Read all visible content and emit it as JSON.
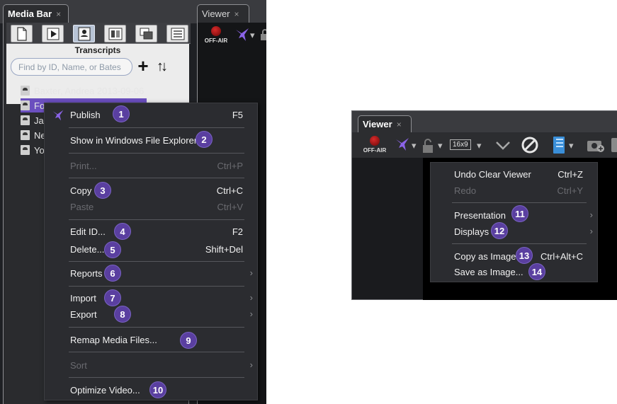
{
  "left": {
    "tabs": {
      "media_bar": "Media Bar",
      "viewer": "Viewer",
      "close_glyph": "×"
    },
    "transcripts_title": "Transcripts",
    "search": {
      "placeholder": "Find by ID, Name, or Bates"
    },
    "plus_glyph": "+",
    "sort_glyph": "↑↓",
    "tree_items": [
      {
        "label": "Baxter, Andrea 2013-09-06"
      },
      {
        "label": "Fo"
      },
      {
        "label": "Ja"
      },
      {
        "label": "Ne"
      },
      {
        "label": "Yo"
      }
    ],
    "context_menu": {
      "publish": {
        "label": "Publish",
        "shortcut": "F5",
        "badge": "1"
      },
      "show_in_explorer": {
        "label": "Show in Windows File Explorer",
        "badge": "2"
      },
      "print": {
        "label": "Print...",
        "shortcut": "Ctrl+P"
      },
      "copy": {
        "label": "Copy",
        "shortcut": "Ctrl+C",
        "badge": "3"
      },
      "paste": {
        "label": "Paste",
        "shortcut": "Ctrl+V"
      },
      "edit_id": {
        "label": "Edit ID...",
        "shortcut": "F2",
        "badge": "4"
      },
      "delete": {
        "label": "Delete...",
        "shortcut": "Shift+Del",
        "badge": "5"
      },
      "reports": {
        "label": "Reports",
        "badge": "6"
      },
      "import": {
        "label": "Import",
        "badge": "7"
      },
      "export": {
        "label": "Export",
        "badge": "8"
      },
      "remap": {
        "label": "Remap Media Files...",
        "badge": "9"
      },
      "sort": {
        "label": "Sort"
      },
      "optimize": {
        "label": "Optimize Video...",
        "badge": "10"
      },
      "submenu_arrow": "›"
    }
  },
  "right": {
    "tab": {
      "viewer": "Viewer",
      "close_glyph": "×"
    },
    "toolbar": {
      "off_air": "OFF-AIR",
      "ratio": "16x9",
      "dropdown_glyph": "▾",
      "check_glyph": "✓"
    },
    "context_menu": {
      "undo": {
        "label": "Undo Clear Viewer",
        "shortcut": "Ctrl+Z"
      },
      "redo": {
        "label": "Redo",
        "shortcut": "Ctrl+Y"
      },
      "presentation": {
        "label": "Presentation",
        "badge": "11"
      },
      "displays": {
        "label": "Displays",
        "badge": "12"
      },
      "copy_image": {
        "label": "Copy as Image",
        "shortcut": "Ctrl+Alt+C",
        "badge": "13"
      },
      "save_image": {
        "label": "Save as Image...",
        "badge": "14"
      },
      "submenu_arrow": "›"
    }
  },
  "colors": {
    "accent_purple": "#6b4fbf",
    "badge_purple": "#5a3fa0",
    "menu_bg": "#2b2c30",
    "panel_bg": "#1e2024",
    "led_red": "#d82a2a"
  },
  "icons": {
    "mediabar_tabs": [
      "document-icon",
      "play-icon",
      "transcript-icon",
      "exhibit-icon",
      "clips-icon",
      "pages-icon"
    ],
    "publish": "publish-bird-icon",
    "lock": "padlock-icon",
    "no_entry": "no-entry-icon",
    "notebook": "notebook-icon",
    "camera": "camera-add-icon"
  }
}
